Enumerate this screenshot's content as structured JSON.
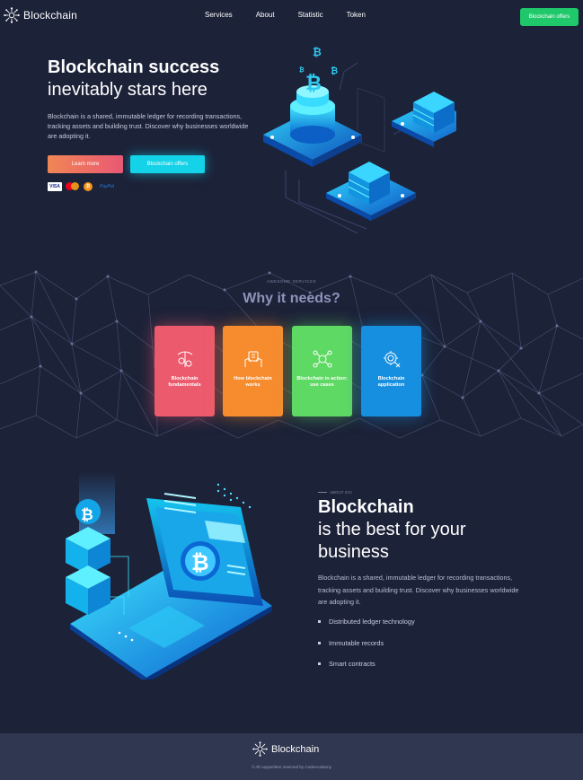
{
  "nav": {
    "brand": "Blockchain",
    "links": [
      "Services",
      "About",
      "Statistic",
      "Token"
    ],
    "cta_label": "Blockchain offers"
  },
  "hero": {
    "title_strong": "Blockchain success",
    "title_light": "inevitably stars here",
    "description": "Blockchain is a shared, immutable ledger for recording transactions, tracking assets and building trust. Discover why businesses worldwide are adopting it.",
    "primary_button": "Learn more",
    "secondary_button": "Blockchain offers",
    "payment_labels": {
      "visa": "VISA",
      "paypal": "PayPal",
      "bitcoin": "₿"
    }
  },
  "services": {
    "eyebrow": "AWESOME SERVICES",
    "title": "Why it needs?",
    "cards": [
      {
        "label": "Blockchain fundamentals",
        "color": "#ec5a6d",
        "icon": "mining-icon"
      },
      {
        "label": "How blockchain works",
        "color": "#f78c2f",
        "icon": "hands-icon"
      },
      {
        "label": "Blockchain in action: use cases",
        "color": "#5ed964",
        "icon": "network-icon"
      },
      {
        "label": "Blockchain application",
        "color": "#168fe0",
        "icon": "gear-coin-icon"
      }
    ]
  },
  "about": {
    "eyebrow": "ABOUT ICO",
    "title_strong": "Blockchain",
    "title_line_1": "is the best for your",
    "title_line_2": "business",
    "description": "Blockchain is a shared, immutable ledger for recording transactions, tracking assets and building trust. Discover why businesses worldwide are adopting it.",
    "features": [
      "Distributed ledger technology",
      "Immutable records",
      "Smart contracts"
    ]
  },
  "footer": {
    "brand": "Blockchain",
    "copyright": "© All copywritten reserved by CodeAcademy"
  },
  "colors": {
    "background": "#1c2238",
    "footer": "#303750",
    "accent_green": "#1fc86a",
    "accent_cyan": "#14d2e8"
  }
}
